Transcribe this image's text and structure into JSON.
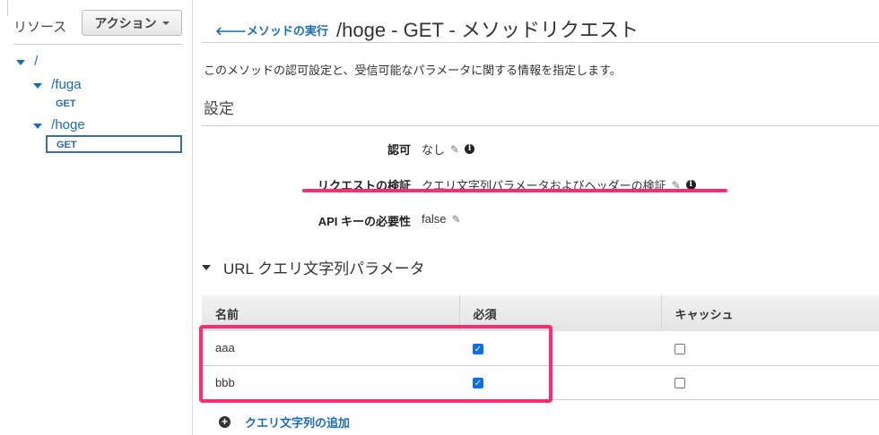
{
  "sidebar": {
    "title": "リソース",
    "action_button": "アクション",
    "tree": [
      {
        "label": "/"
      },
      {
        "label": "/fuga",
        "method": "GET"
      },
      {
        "label": "/hoge",
        "method": "GET"
      }
    ]
  },
  "header": {
    "back_link": "メソッドの実行",
    "title": "/hoge - GET - メソッドリクエスト"
  },
  "description": "このメソッドの認可設定と、受信可能なパラメータに関する情報を指定します。",
  "settings": {
    "heading": "設定",
    "rows": [
      {
        "label": "認可",
        "value": "なし"
      },
      {
        "label": "リクエストの検証",
        "value": "クエリ文字列パラメータおよびヘッダーの検証"
      },
      {
        "label": "API キーの必要性",
        "value": "false"
      }
    ]
  },
  "query_params": {
    "heading": "URL クエリ文字列パラメータ",
    "columns": [
      "名前",
      "必須",
      "キャッシュ"
    ],
    "rows": [
      {
        "name": "aaa",
        "required": true,
        "cache": false
      },
      {
        "name": "bbb",
        "required": true,
        "cache": false
      }
    ],
    "add_link": "クエリ文字列の追加"
  },
  "colors": {
    "link": "#1a6cb9",
    "highlight": "#ff2d6f"
  }
}
